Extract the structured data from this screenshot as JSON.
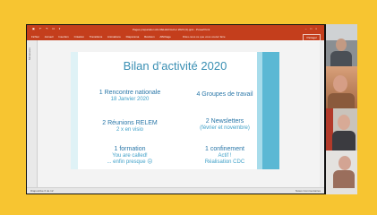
{
  "powerpoint": {
    "window_title": "Pages préparation AG RELEM février 2020 (3).pptx - PowerPoint",
    "quick_access": [
      "▣",
      "↶",
      "↷",
      "⊡",
      "▾"
    ],
    "menu_items": [
      "Fichier",
      "Accueil",
      "Insertion",
      "Création",
      "Transitions",
      "Animations",
      "Diaporama",
      "Révision",
      "Affichage"
    ],
    "search_hint": "Dites-nous ce que vous voulez faire",
    "share_label": "Partager",
    "thumbnails_label": "Miniatures",
    "status_left": "Diapositive 6 de 12",
    "status_right": "Notes   Commentaires"
  },
  "slide": {
    "title": "Bilan d’activité 2020",
    "left_blocks": [
      {
        "heading": "1 Rencontre nationale",
        "sub": "18 Janvier 2020"
      },
      {
        "heading": "2 Réunions RELEM",
        "sub": "2 x en visio"
      },
      {
        "heading": "1 formation",
        "sub": "You are called!",
        "sub2": "... enfin presque ☹"
      }
    ],
    "right_blocks": [
      {
        "heading": "4 Groupes de travail"
      },
      {
        "heading": "2 Newsletters",
        "sub": "(février et novembre)"
      },
      {
        "heading": "1 confinement",
        "sub": "Actif !",
        "sub2": "Réalisation CDC"
      }
    ]
  },
  "colors": {
    "background": "#f7c531",
    "ribbon": "#c43e1c",
    "slide_text": "#2a77a8",
    "slide_accent": "#5bb8d4"
  }
}
